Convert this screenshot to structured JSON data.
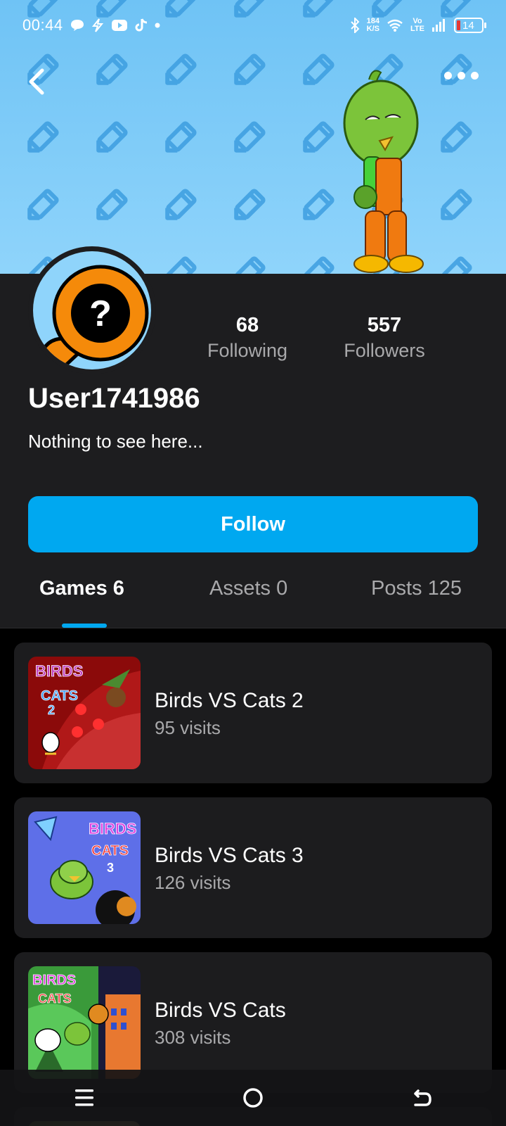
{
  "status_bar": {
    "time": "00:44",
    "net_speed": "184",
    "net_unit": "K/S",
    "volte_top": "Vo",
    "volte_bottom": "LTE",
    "battery": "14"
  },
  "header": {
    "back_icon": "chevron-left-icon",
    "more_icon": "more-horizontal-icon"
  },
  "profile": {
    "username": "User1741986",
    "bio": "Nothing to see here...",
    "following_count": "68",
    "following_label": "Following",
    "followers_count": "557",
    "followers_label": "Followers",
    "follow_label": "Follow",
    "avatar_symbol": "?"
  },
  "tabs": [
    {
      "label": "Games 6",
      "active": true
    },
    {
      "label": "Assets 0",
      "active": false
    },
    {
      "label": "Posts 125",
      "active": false
    }
  ],
  "games": [
    {
      "title": "Birds VS Cats 2",
      "visits": "95 visits"
    },
    {
      "title": "Birds VS Cats 3",
      "visits": "126 visits"
    },
    {
      "title": "Birds VS Cats",
      "visits": "308 visits"
    }
  ],
  "colors": {
    "accent": "#00a8f0",
    "banner": "#8fd4fb",
    "panel": "#1d1d1f",
    "card": "#1c1c1e",
    "muted_text": "#a9a9ab"
  }
}
